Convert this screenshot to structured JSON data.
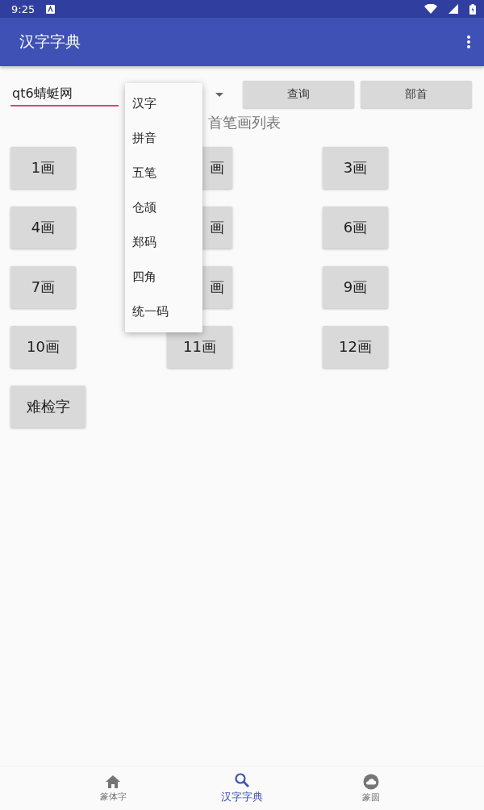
{
  "status_bar": {
    "time": "9:25"
  },
  "app_bar": {
    "title": "汉字字典"
  },
  "search": {
    "value": "qt6蜻蜓网"
  },
  "buttons": [
    {
      "label": "查询"
    },
    {
      "label": "部首"
    }
  ],
  "heading": "首笔画列表",
  "strokes": [
    {
      "label": "1画",
      "partly_hidden": false
    },
    {
      "label": "画",
      "partly_hidden": true
    },
    {
      "label": "3画",
      "partly_hidden": false
    },
    {
      "label": "4画",
      "partly_hidden": false
    },
    {
      "label": "画",
      "partly_hidden": true
    },
    {
      "label": "6画",
      "partly_hidden": false
    },
    {
      "label": "7画",
      "partly_hidden": false
    },
    {
      "label": "画",
      "partly_hidden": true
    },
    {
      "label": "9画",
      "partly_hidden": false
    },
    {
      "label": "10画",
      "partly_hidden": false
    },
    {
      "label": "11画",
      "partly_hidden": false
    },
    {
      "label": "12画",
      "partly_hidden": false
    },
    {
      "label": "难检字",
      "partly_hidden": false
    }
  ],
  "dropdown_menu": [
    "汉字",
    "拼音",
    "五笔",
    "仓颉",
    "郑码",
    "四角",
    "统一码"
  ],
  "bottom_nav": [
    {
      "label": "篆体字",
      "kind": "home",
      "selected": false
    },
    {
      "label": "汉字字典",
      "kind": "search",
      "selected": true
    },
    {
      "label": "篆圆",
      "kind": "cloud",
      "selected": false
    }
  ]
}
